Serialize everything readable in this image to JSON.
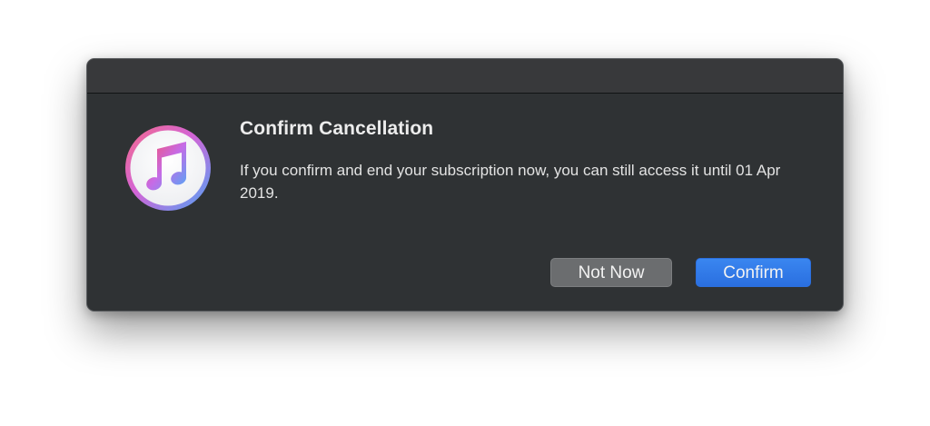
{
  "dialog": {
    "title": "Confirm Cancellation",
    "message": "If you confirm and end your subscription now, you can still access it until 01 Apr 2019.",
    "app_icon": "itunes-music-note-icon",
    "buttons": {
      "secondary_label": "Not Now",
      "primary_label": "Confirm"
    }
  },
  "colors": {
    "dialog_background": "#2f3234",
    "primary_button": "#2f78e8",
    "secondary_button": "#6b6d6f"
  }
}
